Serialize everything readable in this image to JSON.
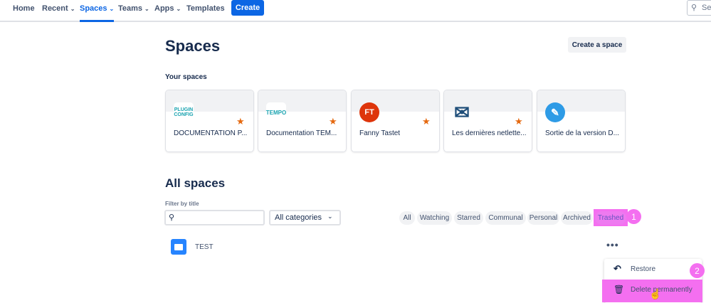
{
  "nav": {
    "items": [
      {
        "label": "Home",
        "dropdown": false
      },
      {
        "label": "Recent",
        "dropdown": true
      },
      {
        "label": "Spaces",
        "dropdown": true,
        "active": true
      },
      {
        "label": "Teams",
        "dropdown": true
      },
      {
        "label": "Apps",
        "dropdown": true
      },
      {
        "label": "Templates",
        "dropdown": false
      }
    ],
    "create_label": "Create",
    "search_placeholder": "Se"
  },
  "page": {
    "title": "Spaces",
    "create_space_label": "Create a space",
    "your_spaces_heading": "Your spaces"
  },
  "your_spaces": [
    {
      "name": "DOCUMENTATION P...",
      "icon": "plugin-config-logo",
      "icon_text": "PLUGIN CONFIG",
      "starred": true
    },
    {
      "name": "Documentation TEM...",
      "icon": "tempo-logo",
      "icon_text": "TEMPO",
      "starred": true
    },
    {
      "name": "Fanny Tastet",
      "icon": "avatar",
      "icon_text": "FT",
      "starred": true
    },
    {
      "name": "Les dernières netlette...",
      "icon": "envelope-icon",
      "starred": true
    },
    {
      "name": "Sortie de la version D...",
      "icon": "calendar-pen-icon",
      "starred": false
    }
  ],
  "all_spaces": {
    "heading": "All spaces",
    "filter_label": "Filter by title",
    "filter_value": "",
    "category_select": "All categories",
    "tabs": [
      "All",
      "Watching",
      "Starred",
      "Communal",
      "Personal",
      "Archived",
      "Trashed"
    ],
    "selected_tab": "Trashed",
    "rows": [
      {
        "name": "TEST",
        "icon": "folder-icon"
      }
    ]
  },
  "menu": {
    "items": [
      {
        "label": "Restore",
        "icon": "undo-icon"
      },
      {
        "label": "Delete permanently",
        "icon": "trash-icon"
      }
    ]
  },
  "annotations": [
    "1",
    "2"
  ],
  "colors": {
    "accent": "#0c66e4",
    "highlight": "#f46ff0",
    "star": "#e56910"
  }
}
